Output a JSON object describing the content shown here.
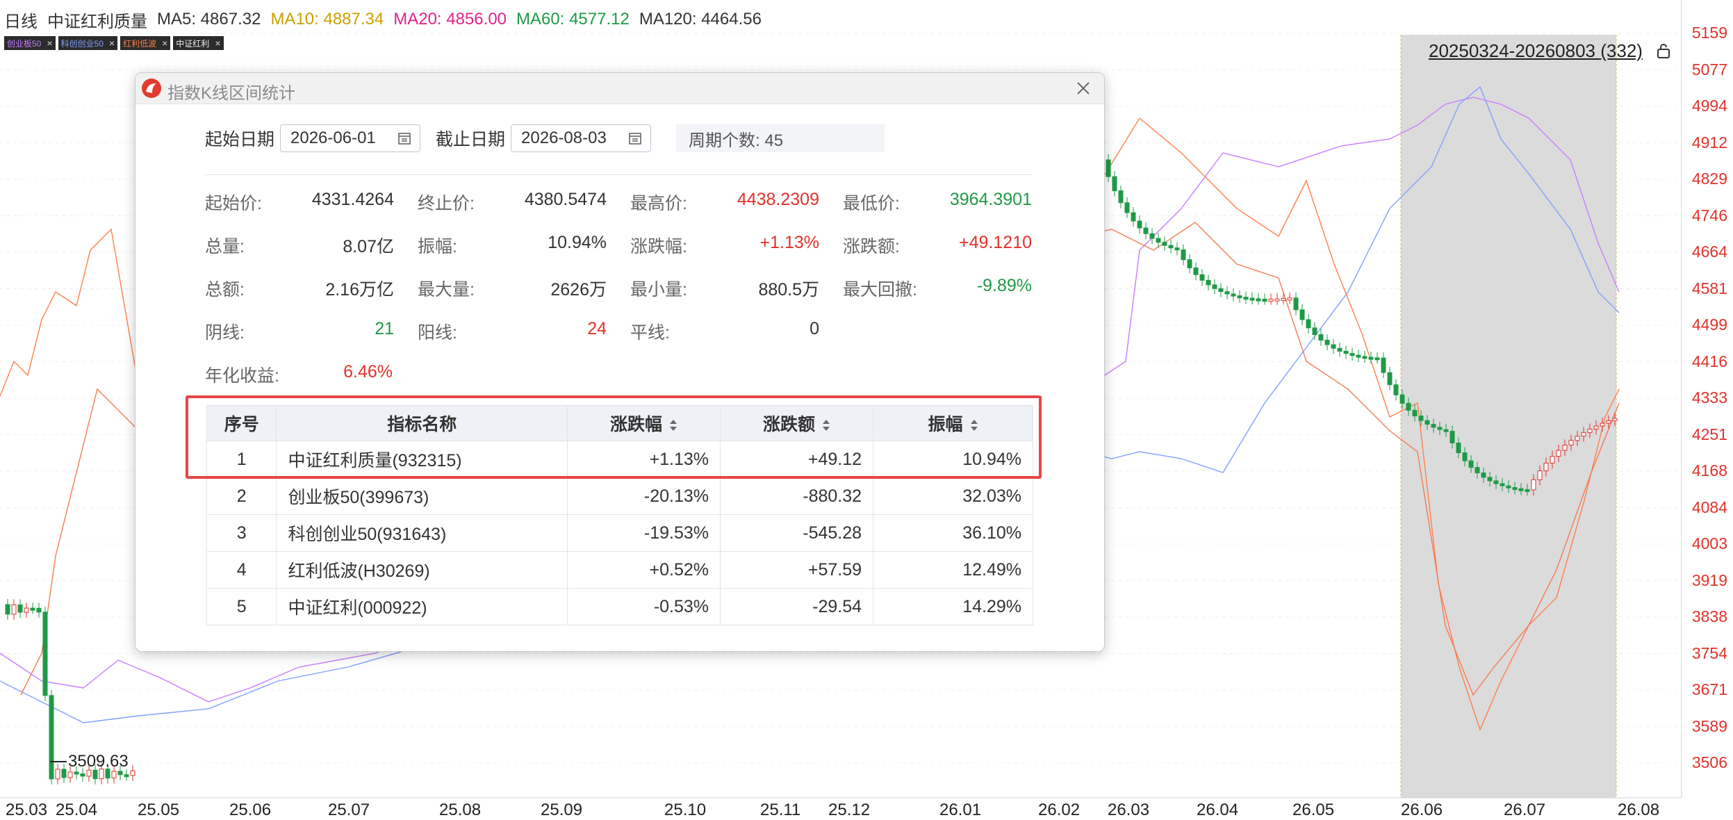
{
  "header": {
    "prefix": "日线",
    "index_name": "中证红利质量",
    "ma": [
      {
        "text": "MA5: 4867.32",
        "color": "#333333"
      },
      {
        "text": "MA10: 4887.34",
        "color": "#c8a000"
      },
      {
        "text": "MA20: 4856.00",
        "color": "#e0228c"
      },
      {
        "text": "MA60: 4577.12",
        "color": "#1e9a46"
      },
      {
        "text": "MA120: 4464.56",
        "color": "#333333"
      }
    ],
    "tags": [
      {
        "label": "创业板50",
        "color": "#c77dff"
      },
      {
        "label": "科创创业50",
        "color": "#7fa0ff"
      },
      {
        "label": "红利低波",
        "color": "#ff7f4a"
      },
      {
        "label": "中证红利",
        "color": "#eeeeee"
      }
    ],
    "tag_close": "×"
  },
  "chart": {
    "range_label": "20250324-20260803 (332)",
    "price_ticks": [
      "5159",
      "5077",
      "4994",
      "4912",
      "4829",
      "4746",
      "4664",
      "4581",
      "4499",
      "4416",
      "4333",
      "4251",
      "4168",
      "4084",
      "4003",
      "3919",
      "3838",
      "3754",
      "3671",
      "3589",
      "3506"
    ],
    "date_ticks": [
      "25.03",
      "25.04",
      "25.05",
      "25.06",
      "25.07",
      "25.08",
      "25.09",
      "25.10",
      "25.11",
      "25.12",
      "26.01",
      "26.02",
      "26.03",
      "26.04",
      "26.05",
      "26.06",
      "26.07",
      "26.08"
    ],
    "low_marker": "3509.63",
    "colors": {
      "up": "#e0322a",
      "down": "#1e9a46",
      "cyb50": "#c77dff",
      "kc50": "#7fa0ff",
      "hllb": "#ff7f4a"
    }
  },
  "dialog": {
    "title": "指数K线区间统计",
    "start_label": "起始日期",
    "start_date": "2026-06-01",
    "end_label": "截止日期",
    "end_date": "2026-08-03",
    "period_label": "周期个数: 45",
    "stats": [
      [
        {
          "label": "起始价:",
          "value": "4331.4264",
          "tone": "dark"
        },
        {
          "label": "终止价:",
          "value": "4380.5474",
          "tone": "dark"
        },
        {
          "label": "最高价:",
          "value": "4438.2309",
          "tone": "red"
        },
        {
          "label": "最低价:",
          "value": "3964.3901",
          "tone": "green"
        }
      ],
      [
        {
          "label": "总量:",
          "value": "8.07亿",
          "tone": "dark"
        },
        {
          "label": "振幅:",
          "value": "10.94%",
          "tone": "dark"
        },
        {
          "label": "涨跌幅:",
          "value": "+1.13%",
          "tone": "red"
        },
        {
          "label": "涨跌额:",
          "value": "+49.1210",
          "tone": "red"
        }
      ],
      [
        {
          "label": "总额:",
          "value": "2.16万亿",
          "tone": "dark"
        },
        {
          "label": "最大量:",
          "value": "2626万",
          "tone": "dark"
        },
        {
          "label": "最小量:",
          "value": "880.5万",
          "tone": "dark"
        },
        {
          "label": "最大回撤:",
          "value": "-9.89%",
          "tone": "green"
        }
      ],
      [
        {
          "label": "阴线:",
          "value": "21",
          "tone": "green"
        },
        {
          "label": "阳线:",
          "value": "24",
          "tone": "red"
        },
        {
          "label": "平线:",
          "value": "0",
          "tone": "dark"
        }
      ],
      [
        {
          "label": "年化收益:",
          "value": "6.46%",
          "tone": "red"
        }
      ]
    ],
    "table": {
      "headers": [
        "序号",
        "指标名称",
        "涨跌幅",
        "涨跌额",
        "振幅"
      ],
      "rows": [
        {
          "no": "1",
          "name": "中证红利质量(932315)",
          "pct": "+1.13%",
          "amt": "+49.12",
          "amp": "10.94%",
          "tone": "red"
        },
        {
          "no": "2",
          "name": "创业板50(399673)",
          "pct": "-20.13%",
          "amt": "-880.32",
          "amp": "32.03%",
          "tone": "green"
        },
        {
          "no": "3",
          "name": "科创创业50(931643)",
          "pct": "-19.53%",
          "amt": "-545.28",
          "amp": "36.10%",
          "tone": "green"
        },
        {
          "no": "4",
          "name": "红利低波(H30269)",
          "pct": "+0.52%",
          "amt": "+57.59",
          "amp": "12.49%",
          "tone": "red"
        },
        {
          "no": "5",
          "name": "中证红利(000922)",
          "pct": "-0.53%",
          "amt": "-29.54",
          "amp": "14.29%",
          "tone": "green"
        }
      ]
    }
  }
}
